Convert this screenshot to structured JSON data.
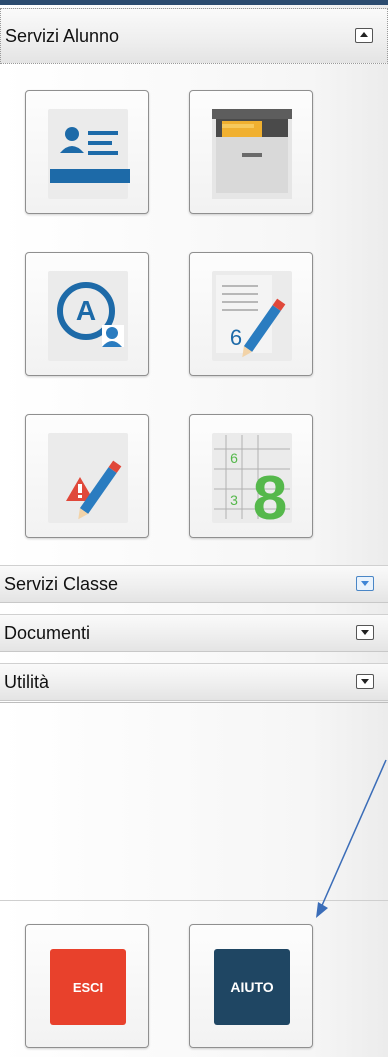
{
  "sections": {
    "alunno": {
      "label": "Servizi Alunno",
      "state": "expanded"
    },
    "classe": {
      "label": "Servizi Classe",
      "state": "collapsed"
    },
    "documenti": {
      "label": "Documenti",
      "state": "collapsed"
    },
    "utilita": {
      "label": "Utilità",
      "state": "collapsed"
    }
  },
  "tiles": [
    {
      "icon": "student-card-icon"
    },
    {
      "icon": "archive-drawer-icon"
    },
    {
      "icon": "attendance-icon"
    },
    {
      "icon": "grades-pencil-icon"
    },
    {
      "icon": "notes-warning-icon"
    },
    {
      "icon": "grade-grid-icon",
      "small_grade_top": "6",
      "small_grade_bottom": "3",
      "big_grade": "8"
    }
  ],
  "bottom_buttons": {
    "exit": {
      "label": "ESCI",
      "color": "#e8412c"
    },
    "help": {
      "label": "AIUTO",
      "color": "#1f4663"
    }
  },
  "colors": {
    "accent_blue": "#1f6fb0",
    "green": "#55b84b",
    "warning_red": "#e0483a"
  }
}
